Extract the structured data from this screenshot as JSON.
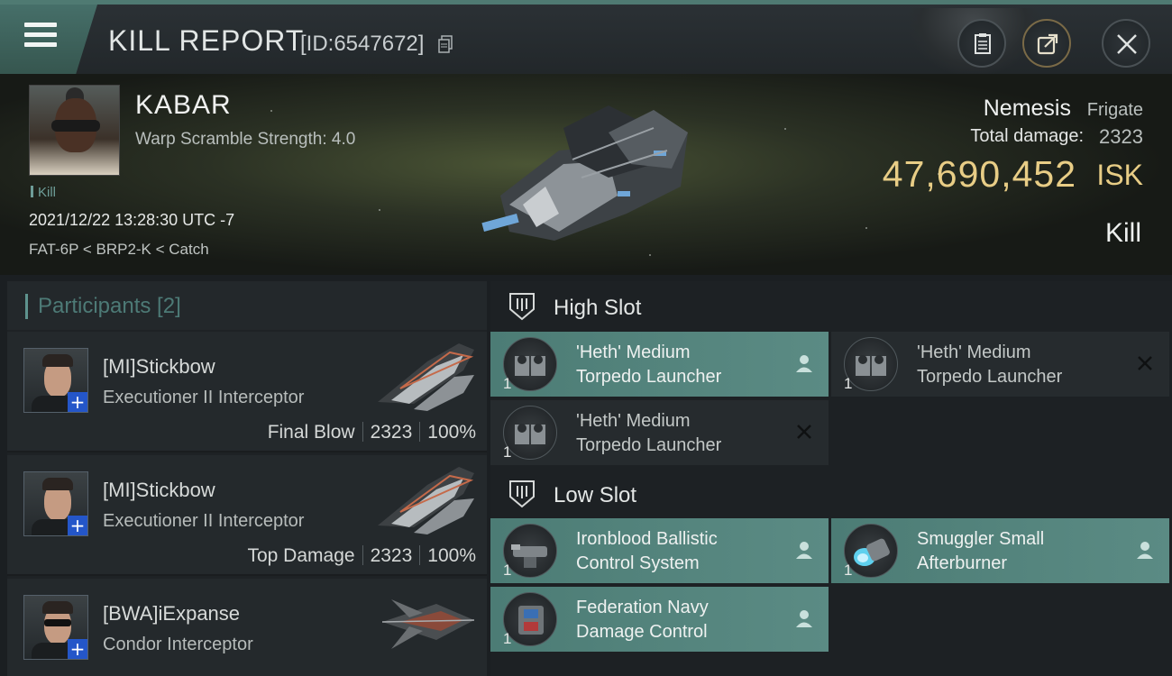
{
  "header": {
    "title": "KILL REPORT",
    "report_id": "[ID:6547672]"
  },
  "victim": {
    "name": "KABAR",
    "warp_scramble": "Warp Scramble Strength: 4.0",
    "kill_tag": "Kill",
    "timestamp": "2021/12/22 13:28:30 UTC -7",
    "location": "FAT-6P < BRP2-K < Catch",
    "ship_name": "Nemesis",
    "ship_class": "Frigate",
    "total_damage_label": "Total damage:",
    "total_damage": "2323",
    "isk_value": "47,690,452",
    "isk_unit": "ISK",
    "kill_type": "Kill"
  },
  "participants": {
    "title": "Participants [2]",
    "items": [
      {
        "name": "[MI]Stickbow",
        "ship": "Executioner II Interceptor",
        "role": "Final Blow",
        "damage": "2323",
        "percent": "100%"
      },
      {
        "name": "[MI]Stickbow",
        "ship": "Executioner II Interceptor",
        "role": "Top Damage",
        "damage": "2323",
        "percent": "100%"
      },
      {
        "name": "[BWA]iExpanse",
        "ship": "Condor Interceptor"
      }
    ]
  },
  "fitting": {
    "high_slot_label": "High Slot",
    "low_slot_label": "Low Slot",
    "high_slot": [
      {
        "line1": "'Heth' Medium",
        "line2": "Torpedo Launcher",
        "qty": "1",
        "status": "fitted"
      },
      {
        "line1": "'Heth' Medium",
        "line2": "Torpedo Launcher",
        "qty": "1",
        "status": "destroyed"
      },
      {
        "line1": "'Heth' Medium",
        "line2": "Torpedo Launcher",
        "qty": "1",
        "status": "destroyed"
      }
    ],
    "low_slot": [
      {
        "line1": "Ironblood Ballistic",
        "line2": "Control System",
        "qty": "1",
        "status": "fitted"
      },
      {
        "line1": "Smuggler Small",
        "line2": "Afterburner",
        "qty": "1",
        "status": "fitted"
      },
      {
        "line1": "Federation Navy",
        "line2": "Damage Control",
        "qty": "1",
        "status": "fitted"
      }
    ]
  },
  "colors": {
    "accent_teal": "#5b8b84",
    "isk_gold": "#e8cd86",
    "plus_badge_blue": "#2456c9"
  },
  "icons": [
    "menu-icon",
    "copy-icon",
    "document-icon",
    "share-icon",
    "close-icon",
    "high-slot-icon",
    "low-slot-icon",
    "pilot-icon",
    "destroyed-x-icon"
  ]
}
